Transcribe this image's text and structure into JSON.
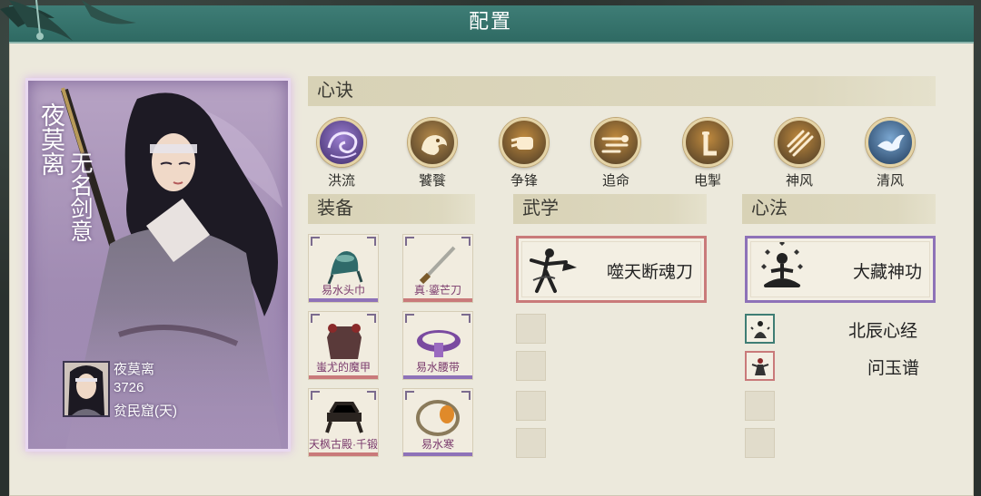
{
  "window": {
    "title": "配置"
  },
  "character": {
    "name_vertical": "夜莫离",
    "title_vertical": "无名剑意",
    "name": "夜莫离",
    "power": "3726",
    "origin": "贫民窟(天)"
  },
  "sections": {
    "xinjue": "心诀",
    "equipment": "装备",
    "wuxue": "武学",
    "xinfa": "心法"
  },
  "xinjue": [
    {
      "label": "洪流",
      "icon": "wave-swirl-icon",
      "color": "#7b5fb0"
    },
    {
      "label": "饕餮",
      "icon": "beast-icon",
      "color": "#b58a4a"
    },
    {
      "label": "争锋",
      "icon": "fist-icon",
      "color": "#c08a3e"
    },
    {
      "label": "追命",
      "icon": "dash-icon",
      "color": "#c08a3e"
    },
    {
      "label": "电掣",
      "icon": "lightning-icon",
      "color": "#c08a3e"
    },
    {
      "label": "神风",
      "icon": "wind-slash-icon",
      "color": "#c08a3e"
    },
    {
      "label": "清风",
      "icon": "bird-icon",
      "color": "#5c86b0"
    }
  ],
  "equipment": [
    {
      "label": "易水头巾",
      "icon": "headband-icon",
      "rarity_color": "#8e72b8"
    },
    {
      "label": "真·鎏芒刀",
      "icon": "blade-icon",
      "rarity_color": "#c97a7a"
    },
    {
      "label": "蚩尤的魔甲",
      "icon": "armor-icon",
      "rarity_color": "#c97a7a"
    },
    {
      "label": "易水腰带",
      "icon": "belt-icon",
      "rarity_color": "#8e72b8"
    },
    {
      "label": "天枫古殿·千锻",
      "icon": "relic-icon",
      "rarity_color": "#c97a7a"
    },
    {
      "label": "易水寒",
      "icon": "bracelet-icon",
      "rarity_color": "#8e72b8"
    }
  ],
  "wuxue": {
    "main": {
      "name": "噬天断魂刀",
      "icon": "swordsman-icon",
      "border_color": "#c97a7a"
    }
  },
  "xinfa": {
    "main": {
      "name": "大藏神功",
      "icon": "meditation-icon",
      "border_color": "#8e72b8"
    },
    "subs": [
      {
        "name": "北辰心经",
        "icon": "monk-icon",
        "border_color": "#3f7d74"
      },
      {
        "name": "问玉谱",
        "icon": "figure-icon",
        "border_color": "#c97a7a"
      }
    ]
  }
}
